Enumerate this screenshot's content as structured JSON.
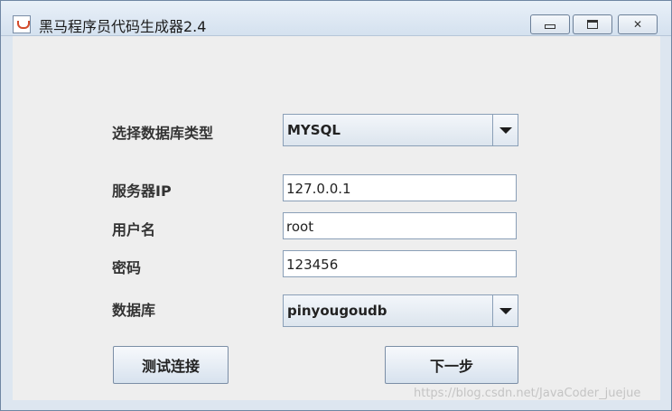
{
  "window": {
    "title": "黑马程序员代码生成器2.4",
    "controls": {
      "minimize": "minimize",
      "maximize": "maximize",
      "close": "close"
    }
  },
  "form": {
    "db_type_label": "选择数据库类型",
    "db_type_value": "MYSQL",
    "server_ip_label": "服务器IP",
    "server_ip_value": "127.0.0.1",
    "username_label": "用户名",
    "username_value": "root",
    "password_label": "密码",
    "password_value": "123456",
    "database_label": "数据库",
    "database_value": "pinyougoudb"
  },
  "buttons": {
    "test_connection": "测试连接",
    "next": "下一步"
  },
  "watermark": "https://blog.csdn.net/JavaCoder_juejue",
  "icons": {
    "app": "java-cup-icon",
    "dropdown": "chevron-down-icon"
  }
}
